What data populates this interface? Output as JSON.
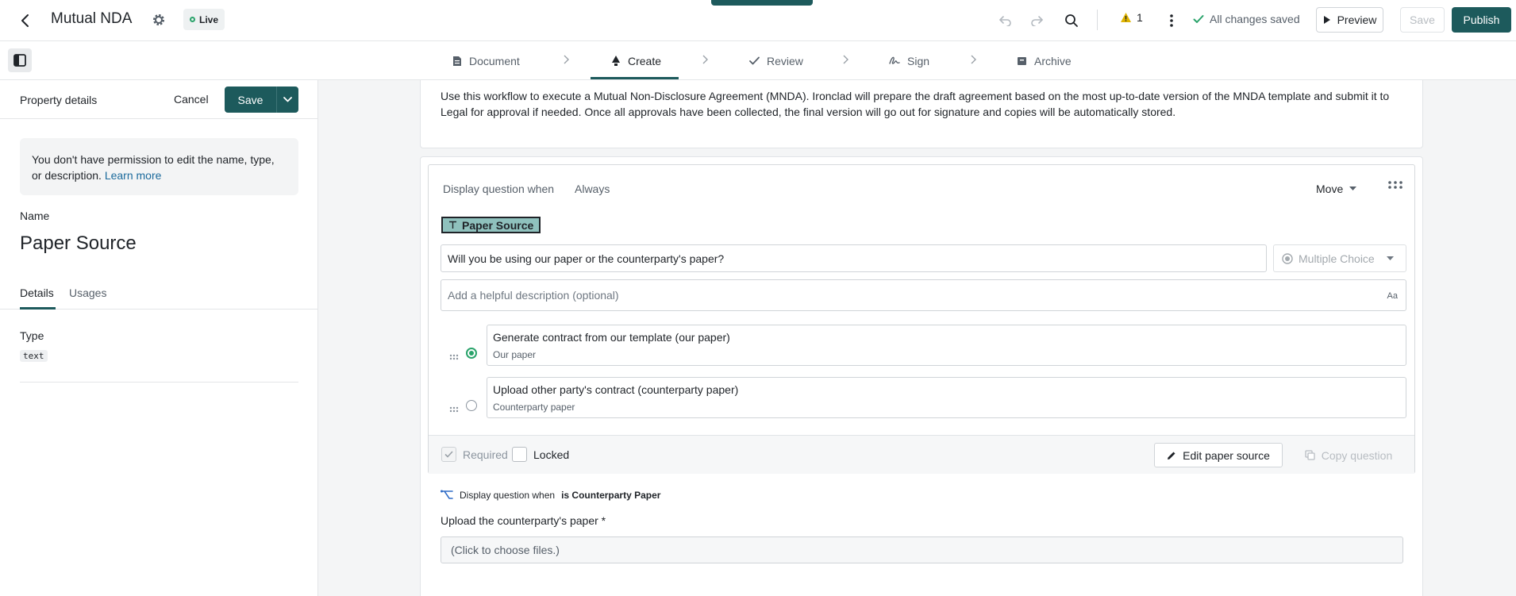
{
  "header": {
    "title": "Mutual NDA",
    "status_badge": "Live",
    "warning_count": "1",
    "saved_status": "All changes saved",
    "preview_label": "Preview",
    "save_label": "Save",
    "publish_label": "Publish",
    "colors": {
      "brand": "#1d5a5c",
      "success": "#2aa36b",
      "warning": "#e0b400"
    }
  },
  "steps": [
    {
      "label": "Document",
      "icon": "document-icon"
    },
    {
      "label": "Create",
      "icon": "create-icon",
      "active": true
    },
    {
      "label": "Review",
      "icon": "check-icon"
    },
    {
      "label": "Sign",
      "icon": "signature-icon"
    },
    {
      "label": "Archive",
      "icon": "archive-icon"
    }
  ],
  "left_panel": {
    "title": "Property details",
    "cancel_label": "Cancel",
    "save_label": "Save",
    "notice_text": "You don't have permission to edit the name, type, or description.",
    "notice_link": "Learn more",
    "name_label": "Name",
    "name_value": "Paper Source",
    "tabs": [
      {
        "label": "Details",
        "active": true
      },
      {
        "label": "Usages"
      }
    ],
    "type_label": "Type",
    "type_value": "text"
  },
  "main": {
    "intro_text": "Use this workflow to execute a Mutual Non-Disclosure Agreement (MNDA). Ironclad will prepare the draft agreement based on the most up-to-date version of the MNDA template and submit it to Legal for approval if needed. Once all approvals have been collected, the final version will go out for signature and copies will be automatically stored.",
    "question": {
      "display_when_label": "Display question when",
      "display_when_value": "Always",
      "move_label": "Move",
      "property_tag": "Paper Source",
      "prompt": "Will you be using our paper or the counterparty's paper?",
      "type": "Multiple Choice",
      "description_placeholder": "Add a helpful description (optional)",
      "description_format_label": "Aa",
      "options": [
        {
          "label": "Generate contract from our template (our paper)",
          "sublabel": "Our paper",
          "selected": true
        },
        {
          "label": "Upload other party's contract (counterparty paper)",
          "sublabel": "Counterparty paper",
          "selected": false
        }
      ],
      "required_label": "Required",
      "required_checked": true,
      "locked_label": "Locked",
      "locked_checked": false,
      "edit_source_label": "Edit paper source",
      "copy_label": "Copy question"
    },
    "conditional": {
      "prefix": "Display question when",
      "condition": "is Counterparty Paper",
      "field_label": "Upload the counterparty's paper *",
      "file_placeholder": "(Click to choose files.)"
    }
  }
}
